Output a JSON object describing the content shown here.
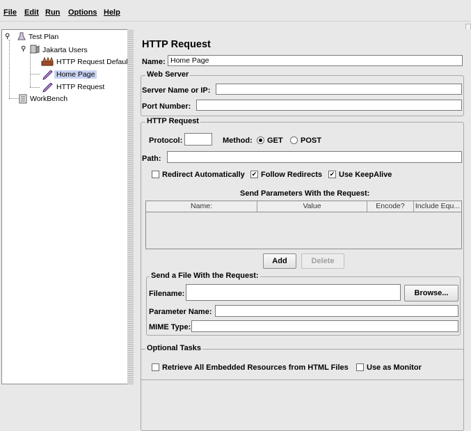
{
  "menu": [
    "File",
    "Edit",
    "Run",
    "Options",
    "Help"
  ],
  "tree": {
    "test_plan": "Test Plan",
    "thread_group": "Jakarta Users",
    "defaults": "HTTP Request Defaults",
    "home_page": "Home Page",
    "http_request": "HTTP Request",
    "workbench": "WorkBench"
  },
  "panel": {
    "title": "HTTP Request",
    "name_label": "Name:",
    "name_value": "Home Page",
    "web_server": {
      "title": "Web Server",
      "server_label": "Server Name or IP:",
      "server_value": "",
      "port_label": "Port Number:",
      "port_value": ""
    },
    "http_request": {
      "title": "HTTP Request",
      "protocol_label": "Protocol:",
      "protocol_value": "",
      "method_label": "Method:",
      "method_get": "GET",
      "method_post": "POST",
      "method_selected": "GET",
      "path_label": "Path:",
      "path_value": "",
      "redirect_auto": "Redirect Automatically",
      "follow_redirects": "Follow Redirects",
      "keepalive": "Use KeepAlive",
      "redirect_auto_checked": false,
      "follow_redirects_checked": true,
      "keepalive_checked": true,
      "params_title": "Send Parameters With the Request:",
      "columns": [
        "Name:",
        "Value",
        "Encode?",
        "Include Equ..."
      ],
      "add_button": "Add",
      "delete_button": "Delete"
    },
    "file": {
      "title": "Send a File With the Request:",
      "filename_label": "Filename:",
      "filename_value": "",
      "browse_button": "Browse...",
      "param_name_label": "Parameter Name:",
      "param_name_value": "",
      "mime_label": "MIME Type:",
      "mime_value": ""
    },
    "optional": {
      "title": "Optional Tasks",
      "retrieve_label": "Retrieve All Embedded Resources from HTML Files",
      "monitor_label": "Use as Monitor",
      "retrieve_checked": false,
      "monitor_checked": false
    }
  }
}
